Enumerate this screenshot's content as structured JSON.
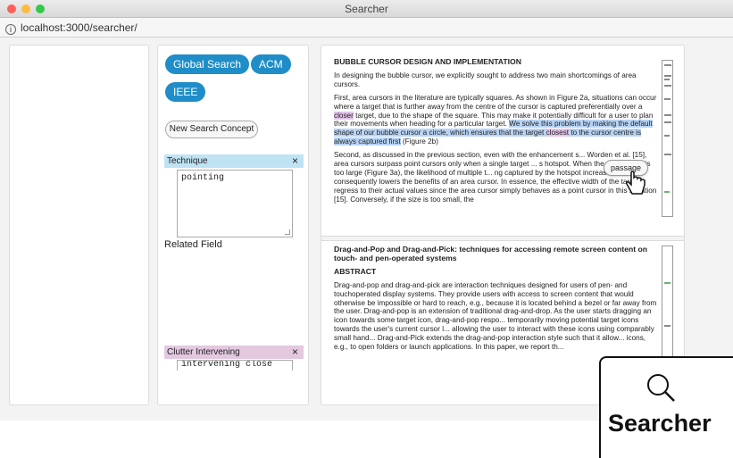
{
  "window": {
    "title": "Searcher"
  },
  "address": {
    "url": "localhost:3000/searcher/"
  },
  "sources": [
    {
      "label": "Global Search"
    },
    {
      "label": "ACM"
    },
    {
      "label": "IEEE"
    }
  ],
  "new_concept_label": "New Search Concept",
  "concepts": [
    {
      "name": "Technique",
      "value": "pointing",
      "close": "×",
      "color": "#bfe3f3"
    },
    {
      "name": "Clutter Intervening",
      "value": "intervening close",
      "close": "×",
      "color": "#e3c8e0"
    }
  ],
  "related_field_label": "Related Field",
  "results": [
    {
      "heading": "BUBBLE CURSOR DESIGN AND IMPLEMENTATION",
      "p1": "In designing the bubble cursor, we explicitly sought to address two main shortcomings of area cursors.",
      "p2_a": "First, area cursors in the literature are typically squares. As shown in Figure 2a, situations can occur where a target that is further away from the centre of the cursor is captured preferentially over a ",
      "p2_closer": "closer",
      "p2_b": " target, due to the shape of the square. This may make it potentially difficult for a user to plan their movements when heading for a particular target. ",
      "p2_hl1": "We solve this problem by making the default shape of our bubble cursor a circle, which ensures that the target ",
      "p2_closest": "closest",
      "p2_hl2": " to the cursor centre is always captured first",
      "p2_c": " (Figure 2b)",
      "p3": "Second, as discussed in the previous section, even with the enhancement s... Worden et al. [15], area cursors surpass point cursors only when a single target ... s hotspot. When the area cursor is too large (Figure 3a), the likelihood of multiple t... ng captured by the hotspot increases, and consequently lowers the benefits of an area cursor. In essence, the effective width of the targets regress to their actual values since the area cursor simply behaves as a point cursor in this situation [15]. Conversely, if the size is too small, the"
    },
    {
      "title": "Drag-and-Pop and Drag-and-Pick: techniques for accessing remote screen content on touch- and pen-operated systems",
      "abstract_label": "ABSTRACT",
      "abstract": "Drag-and-pop and drag-and-pick are interaction techniques designed for users of pen- and touchoperated display systems. They provide users with access to screen content that would otherwise be impossible or hard to reach, e.g., because it is located behind a bezel or far away from the user. Drag-and-pop is an extension of traditional drag-and-drop. As the user starts dragging an icon towards some target icon, drag-and-pop respo... temporarily moving potential target icons towards the user's current cursor l... allowing the user to interact with these icons using comparably small hand... Drag-and-Pick extends the drag-and-pop interaction style such that it allow... icons, e.g., to open folders or launch applications. In this paper, we report th..."
    }
  ],
  "tooltip": {
    "label": "passage"
  },
  "brand": {
    "label": "Searcher"
  },
  "colors": {
    "accent": "#1f8ec8",
    "highlight_blue": "#b8d4f5",
    "highlight_pink": "#e2c4e9"
  }
}
